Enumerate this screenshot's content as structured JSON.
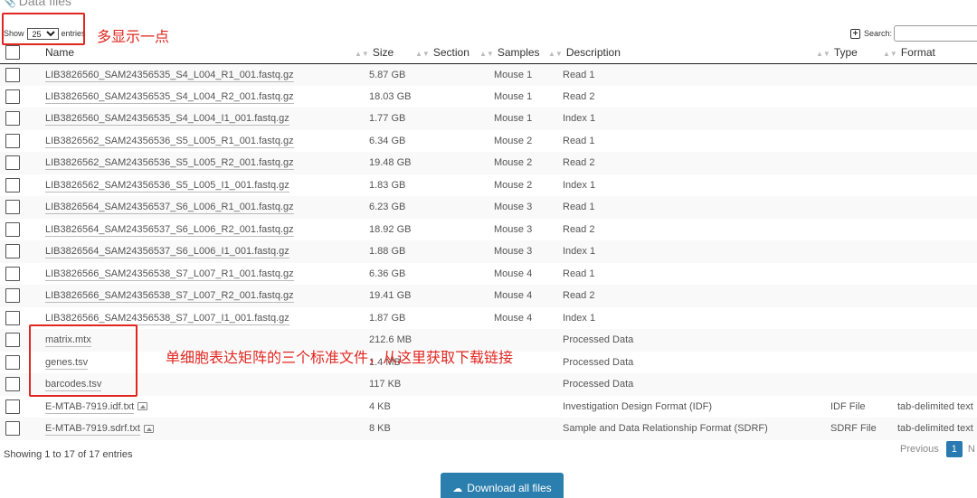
{
  "section": {
    "title": "Data files",
    "icon": "paperclip-icon"
  },
  "length": {
    "show_label": "Show",
    "value": "25",
    "entries_label": "entries"
  },
  "search": {
    "label": "Search:",
    "value": ""
  },
  "annotations": {
    "entries_note": "多显示一点",
    "processed_note": "单细胞表达矩阵的三个标准文件，从这里获取下载链接"
  },
  "columns": {
    "name": "Name",
    "size": "Size",
    "section": "Section",
    "samples": "Samples",
    "description": "Description",
    "type": "Type",
    "format": "Format"
  },
  "rows": [
    {
      "name": "LIB3826560_SAM24356535_S4_L004_R1_001.fastq.gz",
      "size": "5.87 GB",
      "section": "",
      "samples": "Mouse 1",
      "description": "Read 1",
      "type": "",
      "format": "",
      "image": false
    },
    {
      "name": "LIB3826560_SAM24356535_S4_L004_R2_001.fastq.gz",
      "size": "18.03 GB",
      "section": "",
      "samples": "Mouse 1",
      "description": "Read 2",
      "type": "",
      "format": "",
      "image": false
    },
    {
      "name": "LIB3826560_SAM24356535_S4_L004_I1_001.fastq.gz",
      "size": "1.77 GB",
      "section": "",
      "samples": "Mouse 1",
      "description": "Index 1",
      "type": "",
      "format": "",
      "image": false
    },
    {
      "name": "LIB3826562_SAM24356536_S5_L005_R1_001.fastq.gz",
      "size": "6.34 GB",
      "section": "",
      "samples": "Mouse 2",
      "description": "Read 1",
      "type": "",
      "format": "",
      "image": false
    },
    {
      "name": "LIB3826562_SAM24356536_S5_L005_R2_001.fastq.gz",
      "size": "19.48 GB",
      "section": "",
      "samples": "Mouse 2",
      "description": "Read 2",
      "type": "",
      "format": "",
      "image": false
    },
    {
      "name": "LIB3826562_SAM24356536_S5_L005_I1_001.fastq.gz",
      "size": "1.83 GB",
      "section": "",
      "samples": "Mouse 2",
      "description": "Index 1",
      "type": "",
      "format": "",
      "image": false
    },
    {
      "name": "LIB3826564_SAM24356537_S6_L006_R1_001.fastq.gz",
      "size": "6.23 GB",
      "section": "",
      "samples": "Mouse 3",
      "description": "Read 1",
      "type": "",
      "format": "",
      "image": false
    },
    {
      "name": "LIB3826564_SAM24356537_S6_L006_R2_001.fastq.gz",
      "size": "18.92 GB",
      "section": "",
      "samples": "Mouse 3",
      "description": "Read 2",
      "type": "",
      "format": "",
      "image": false
    },
    {
      "name": "LIB3826564_SAM24356537_S6_L006_I1_001.fastq.gz",
      "size": "1.88 GB",
      "section": "",
      "samples": "Mouse 3",
      "description": "Index 1",
      "type": "",
      "format": "",
      "image": false
    },
    {
      "name": "LIB3826566_SAM24356538_S7_L007_R1_001.fastq.gz",
      "size": "6.36 GB",
      "section": "",
      "samples": "Mouse 4",
      "description": "Read 1",
      "type": "",
      "format": "",
      "image": false
    },
    {
      "name": "LIB3826566_SAM24356538_S7_L007_R2_001.fastq.gz",
      "size": "19.41 GB",
      "section": "",
      "samples": "Mouse 4",
      "description": "Read 2",
      "type": "",
      "format": "",
      "image": false
    },
    {
      "name": "LIB3826566_SAM24356538_S7_L007_I1_001.fastq.gz",
      "size": "1.87 GB",
      "section": "",
      "samples": "Mouse 4",
      "description": "Index 1",
      "type": "",
      "format": "",
      "image": false
    },
    {
      "name": "matrix.mtx",
      "size": "212.6 MB",
      "section": "",
      "samples": "",
      "description": "Processed Data",
      "type": "",
      "format": "",
      "image": false
    },
    {
      "name": "genes.tsv",
      "size": "1.4 MB",
      "section": "",
      "samples": "",
      "description": "Processed Data",
      "type": "",
      "format": "",
      "image": false
    },
    {
      "name": "barcodes.tsv",
      "size": "117 KB",
      "section": "",
      "samples": "",
      "description": "Processed Data",
      "type": "",
      "format": "",
      "image": false
    },
    {
      "name": "E-MTAB-7919.idf.txt",
      "size": "4 KB",
      "section": "",
      "samples": "",
      "description": "Investigation Design Format (IDF)",
      "type": "IDF File",
      "format": "tab-delimited text",
      "image": true
    },
    {
      "name": "E-MTAB-7919.sdrf.txt",
      "size": "8 KB",
      "section": "",
      "samples": "",
      "description": "Sample and Data Relationship Format (SDRF)",
      "type": "SDRF File",
      "format": "tab-delimited text",
      "image": true
    }
  ],
  "info": "Showing 1 to 17 of 17 entries",
  "pagination": {
    "previous": "Previous",
    "current": "1",
    "next": "N"
  },
  "download_button": {
    "label": "Download all files",
    "icon": "cloud-download-icon"
  },
  "colors": {
    "annotation": "#e0261f",
    "primary": "#2b7fae",
    "page_active": "#2a79b0"
  }
}
